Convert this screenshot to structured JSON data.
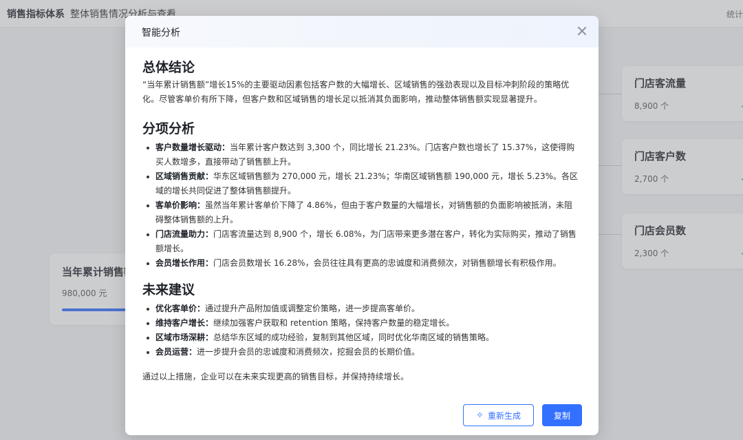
{
  "page": {
    "title": "销售指标体系",
    "subtitle": "整体销售情况分析与查看",
    "top_right": "统计"
  },
  "background": {
    "cards": [
      {
        "title": "门店客流量",
        "value": "8,900 个"
      },
      {
        "title": "门店客户数",
        "value": "2,700 个"
      },
      {
        "title": "门店会员数",
        "value": "2,300 个"
      }
    ],
    "main_card": {
      "title": "当年累计销售额",
      "value": "980,000 元"
    }
  },
  "modal": {
    "title": "智能分析",
    "sections": {
      "conclusion": {
        "heading": "总体结论",
        "text": "“当年累计销售额”增长15%的主要驱动因素包括客户数的大幅增长、区域销售的强劲表现以及目标冲刺阶段的策略优化。尽管客单价有所下降，但客户数和区域销售的增长足以抵消其负面影响，推动整体销售额实现显著提升。"
      },
      "analysis": {
        "heading": "分项分析",
        "items": [
          {
            "label": "客户数量增长驱动：",
            "text": "当年累计客户数达到 3,300 个，同比增长 21.23%。门店客户数也增长了 15.37%，这使得购买人数增多，直接带动了销售额上升。"
          },
          {
            "label": "区域销售贡献：",
            "text": "华东区域销售额为 270,000 元，增长 21.23%；华南区域销售额 190,000 元，增长 5.23%。各区域的增长共同促进了整体销售额提升。"
          },
          {
            "label": "客单价影响：",
            "text": "虽然当年累计客单价下降了 4.86%，但由于客户数量的大幅增长，对销售额的负面影响被抵消，未阻碍整体销售额的上升。"
          },
          {
            "label": "门店流量助力：",
            "text": "门店客流量达到 8,900 个，增长 6.08%，为门店带来更多潜在客户，转化为实际购买，推动了销售额增长。"
          },
          {
            "label": "会员增长作用：",
            "text": "门店会员数增长 16.28%，会员往往具有更高的忠诚度和消费频次，对销售额增长有积极作用。"
          }
        ]
      },
      "suggestions": {
        "heading": "未来建议",
        "items": [
          {
            "label": "优化客单价：",
            "text": "通过提升产品附加值或调整定价策略，进一步提高客单价。"
          },
          {
            "label": "维持客户增长：",
            "text": "继续加强客户获取和 retention 策略，保持客户数量的稳定增长。"
          },
          {
            "label": "区域市场深耕：",
            "text": "总结华东区域的成功经验，复制到其他区域，同时优化华南区域的销售策略。"
          },
          {
            "label": "会员运营：",
            "text": "进一步提升会员的忠诚度和消费频次，挖掘会员的长期价值。"
          }
        ]
      },
      "closing": "通过以上措施，企业可以在未来实现更高的销售目标，并保持持续增长。"
    },
    "buttons": {
      "regenerate": "重新生成",
      "copy": "复制"
    },
    "icons": {
      "close": "close-icon",
      "regenerate": "sparkle-icon"
    },
    "colors": {
      "primary": "#3370ff"
    }
  }
}
